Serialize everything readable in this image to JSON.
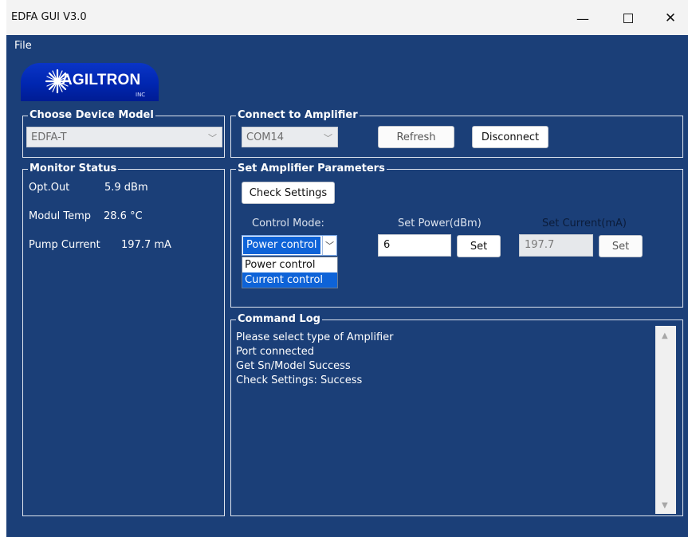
{
  "window": {
    "title": "EDFA GUI V3.0",
    "minimize": "—",
    "close": "✕"
  },
  "menu": {
    "file": "File"
  },
  "logo": {
    "text": "AGILTRON",
    "inc": "INC"
  },
  "device_model": {
    "legend": "Choose Device Model",
    "selected": "EDFA-T"
  },
  "connect": {
    "legend": "Connect to Amplifier",
    "port": "COM14",
    "refresh_label": "Refresh",
    "disconnect_label": "Disconnect"
  },
  "monitor": {
    "legend": "Monitor Status",
    "opt_out_label": "Opt.Out",
    "opt_out_value": "5.9 dBm",
    "temp_label": "Modul Temp",
    "temp_value": "28.6 °C",
    "pump_label": "Pump Current",
    "pump_value": "197.7 mA"
  },
  "params": {
    "legend": "Set Amplifier Parameters",
    "check_label": "Check Settings",
    "control_mode_label": "Control Mode:",
    "control_mode_selected": "Power control",
    "control_mode_options": [
      "Power control",
      "Current control"
    ],
    "set_power_label": "Set Power(dBm)",
    "set_power_value": "6",
    "set_power_button": "Set",
    "set_current_label": "Set Current(mA)",
    "set_current_value": "197.7",
    "set_current_button": "Set"
  },
  "log": {
    "legend": "Command Log",
    "lines": [
      "Please select type of Amplifier",
      "Port connected",
      "Get Sn/Model Success",
      "Check Settings: Success"
    ]
  },
  "icons": {
    "dropdown_arrow": "chevron-down-icon",
    "scroll_up": "triangle-up-icon",
    "scroll_down": "triangle-down-icon"
  }
}
